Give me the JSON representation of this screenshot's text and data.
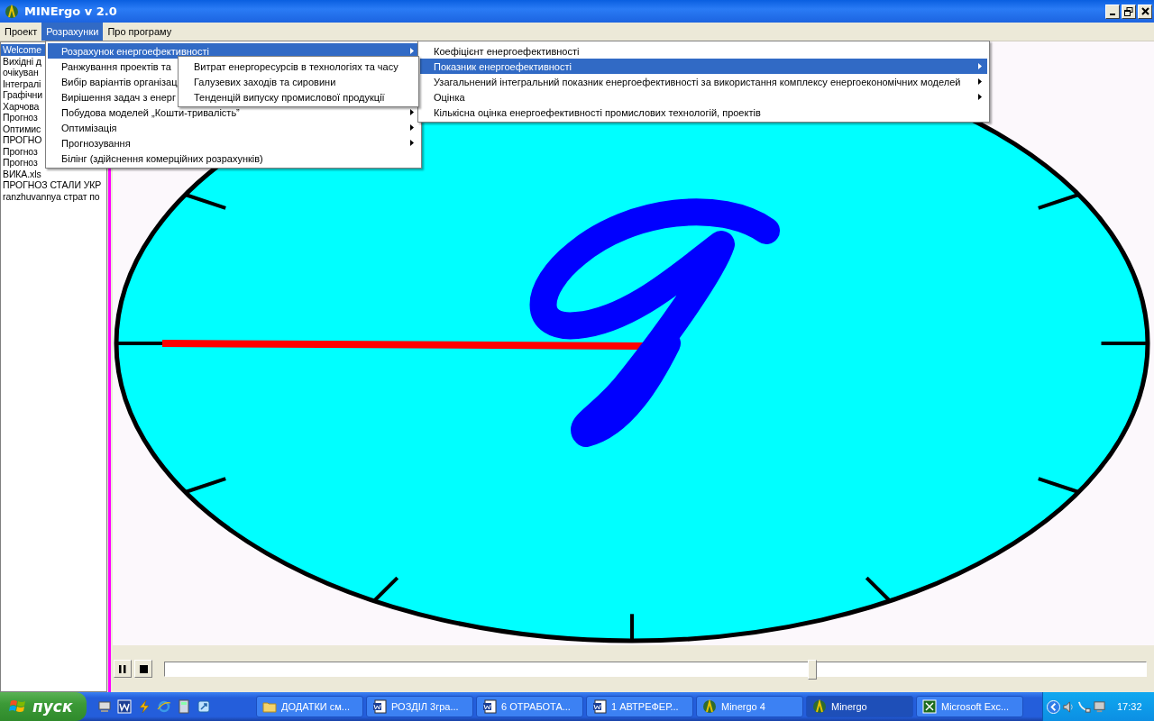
{
  "window": {
    "title": "MINErgo v 2.0"
  },
  "menu_bar": [
    {
      "label": "Проект",
      "selected": false
    },
    {
      "label": "Розрахунки",
      "selected": true
    },
    {
      "label": "Про програму",
      "selected": false
    }
  ],
  "sidebar": {
    "items": [
      {
        "label": "Welcome",
        "selected": true
      },
      {
        "label": "Вихідні д",
        "selected": false
      },
      {
        "label": "очікуван",
        "selected": false
      },
      {
        "label": "Інтегралі",
        "selected": false
      },
      {
        "label": "Графічни",
        "selected": false
      },
      {
        "label": "Харчова",
        "selected": false
      },
      {
        "label": "Прогноз",
        "selected": false
      },
      {
        "label": "Оптимис",
        "selected": false
      },
      {
        "label": "ПРОГНО",
        "selected": false
      },
      {
        "label": "Прогноз",
        "selected": false
      },
      {
        "label": "Прогноз",
        "selected": false
      },
      {
        "label": "ВИКА.xls",
        "selected": false
      },
      {
        "label": "ПРОГНОЗ СТАЛИ УКР",
        "selected": false
      },
      {
        "label": "ranzhuvannya страт по",
        "selected": false
      }
    ]
  },
  "menus": [
    {
      "items": [
        {
          "label": "Розрахунок енергоефективності",
          "has_submenu": true,
          "selected": true
        },
        {
          "label": "Ранжування проектів та",
          "has_submenu": false,
          "selected": false
        },
        {
          "label": "Вибір варіантів організац",
          "has_submenu": false,
          "selected": false
        },
        {
          "label": "Вирішення задач з енерг",
          "has_submenu": false,
          "selected": false
        },
        {
          "label": "Побудова моделей „Кошти-тривалість”",
          "has_submenu": true,
          "selected": false
        },
        {
          "label": "Оптимізація",
          "has_submenu": true,
          "selected": false
        },
        {
          "label": "Прогнозування",
          "has_submenu": true,
          "selected": false
        },
        {
          "label": "Білінг (здійснення комерційних розрахунків)",
          "has_submenu": false,
          "selected": false
        }
      ]
    },
    {
      "items": [
        {
          "label": "Витрат енергоресурсів в технологіях та часу",
          "has_submenu": false,
          "selected": false
        },
        {
          "label": "Галузевих заходів та сировини",
          "has_submenu": false,
          "selected": false
        },
        {
          "label": "Тенденцій випуску промислової продукції",
          "has_submenu": false,
          "selected": false
        }
      ]
    },
    {
      "items": [
        {
          "label": "Коефіцієнт енергоефективності",
          "has_submenu": false,
          "selected": false
        },
        {
          "label": "Показник енергоефективності",
          "has_submenu": true,
          "selected": true
        },
        {
          "label": "Узагальнений інтегральний показник енергоефективності за використання комплексу енергоекономічних моделей",
          "has_submenu": true,
          "selected": false
        },
        {
          "label": "Оцінка",
          "has_submenu": true,
          "selected": false
        },
        {
          "label": "Кількісна оцінка енергоефективності промислових технологій, проектів",
          "has_submenu": false,
          "selected": false
        }
      ]
    }
  ],
  "player": {
    "slider": {
      "level": 0.66
    }
  },
  "taskbar": {
    "start": "пуск",
    "tasks": [
      {
        "label": "ДОДАТКИ см...",
        "kind": "folder",
        "selected": false
      },
      {
        "label": "РОЗДІЛ 3гра...",
        "kind": "word",
        "selected": false
      },
      {
        "label": "6 ОТРАБОТА...",
        "kind": "word",
        "selected": false
      },
      {
        "label": "1 АВТРЕФЕР...",
        "kind": "word",
        "selected": false
      },
      {
        "label": "Minergo 4",
        "kind": "app",
        "selected": false
      },
      {
        "label": "Minergo",
        "kind": "app",
        "selected": true
      },
      {
        "label": "Microsoft Exc...",
        "kind": "excel",
        "selected": false
      }
    ],
    "clock": "17:32"
  }
}
